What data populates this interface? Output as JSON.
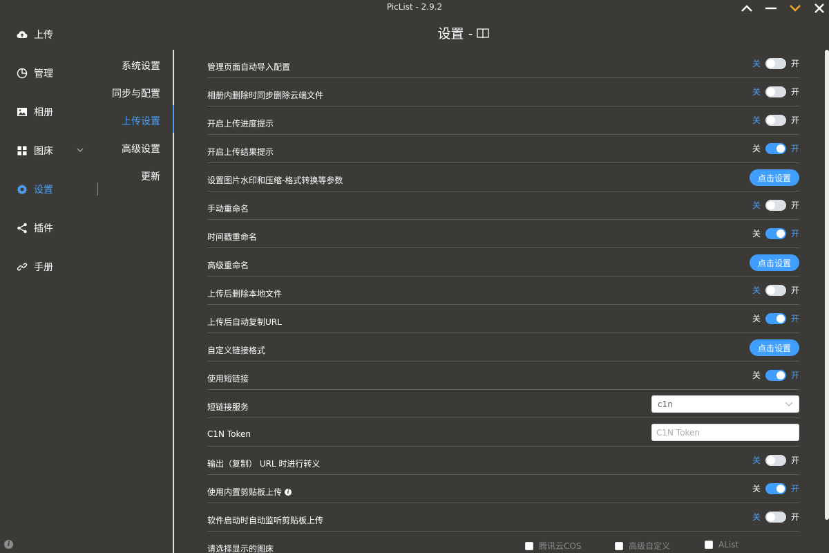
{
  "window": {
    "title": "PicList - 2.9.2",
    "page_title": "设置 -"
  },
  "sidebar": {
    "items": [
      {
        "label": "上传",
        "icon": "upload-cloud-icon"
      },
      {
        "label": "管理",
        "icon": "pie-chart-icon"
      },
      {
        "label": "相册",
        "icon": "picture-icon"
      },
      {
        "label": "图床",
        "icon": "grid-icon"
      },
      {
        "label": "设置",
        "icon": "gear-icon",
        "active": true
      },
      {
        "label": "插件",
        "icon": "share-icon"
      },
      {
        "label": "手册",
        "icon": "link-icon"
      }
    ]
  },
  "submenu": {
    "items": [
      {
        "label": "系统设置"
      },
      {
        "label": "同步与配置"
      },
      {
        "label": "上传设置",
        "active": true
      },
      {
        "label": "高级设置"
      },
      {
        "label": "更新"
      }
    ]
  },
  "settings": {
    "off_label": "关",
    "on_label": "开",
    "button_label": "点击设置",
    "rows": [
      {
        "label": "管理页面自动导入配置",
        "type": "switch",
        "on": false
      },
      {
        "label": "相册内删除时同步删除云端文件",
        "type": "switch",
        "on": false
      },
      {
        "label": "开启上传进度提示",
        "type": "switch",
        "on": false
      },
      {
        "label": "开启上传结果提示",
        "type": "switch",
        "on": true
      },
      {
        "label": "设置图片水印和压缩-格式转换等参数",
        "type": "button"
      },
      {
        "label": "手动重命名",
        "type": "switch",
        "on": false
      },
      {
        "label": "时间戳重命名",
        "type": "switch",
        "on": true
      },
      {
        "label": "高级重命名",
        "type": "button"
      },
      {
        "label": "上传后删除本地文件",
        "type": "switch",
        "on": false
      },
      {
        "label": "上传后自动复制URL",
        "type": "switch",
        "on": true
      },
      {
        "label": "自定义链接格式",
        "type": "button"
      },
      {
        "label": "使用短链接",
        "type": "switch",
        "on": true
      },
      {
        "label": "短链接服务",
        "type": "select",
        "value": "c1n"
      },
      {
        "label": "C1N Token",
        "type": "input",
        "placeholder": "C1N Token"
      },
      {
        "label": "输出（复制） URL 时进行转义",
        "type": "switch",
        "on": false
      },
      {
        "label": "使用内置剪贴板上传",
        "type": "switch",
        "on": true,
        "info": true
      },
      {
        "label": "软件启动时自动监听剪贴板上传",
        "type": "switch",
        "on": false
      }
    ],
    "picbed_row": {
      "label": "请选择显示的图床",
      "options": [
        "腾讯云COS",
        "高级自定义",
        "AList"
      ]
    }
  },
  "colors": {
    "background": "#3c3a37",
    "accent": "#409eff",
    "active_text": "#4a9ff5",
    "window_chevron": "#f5a623"
  }
}
